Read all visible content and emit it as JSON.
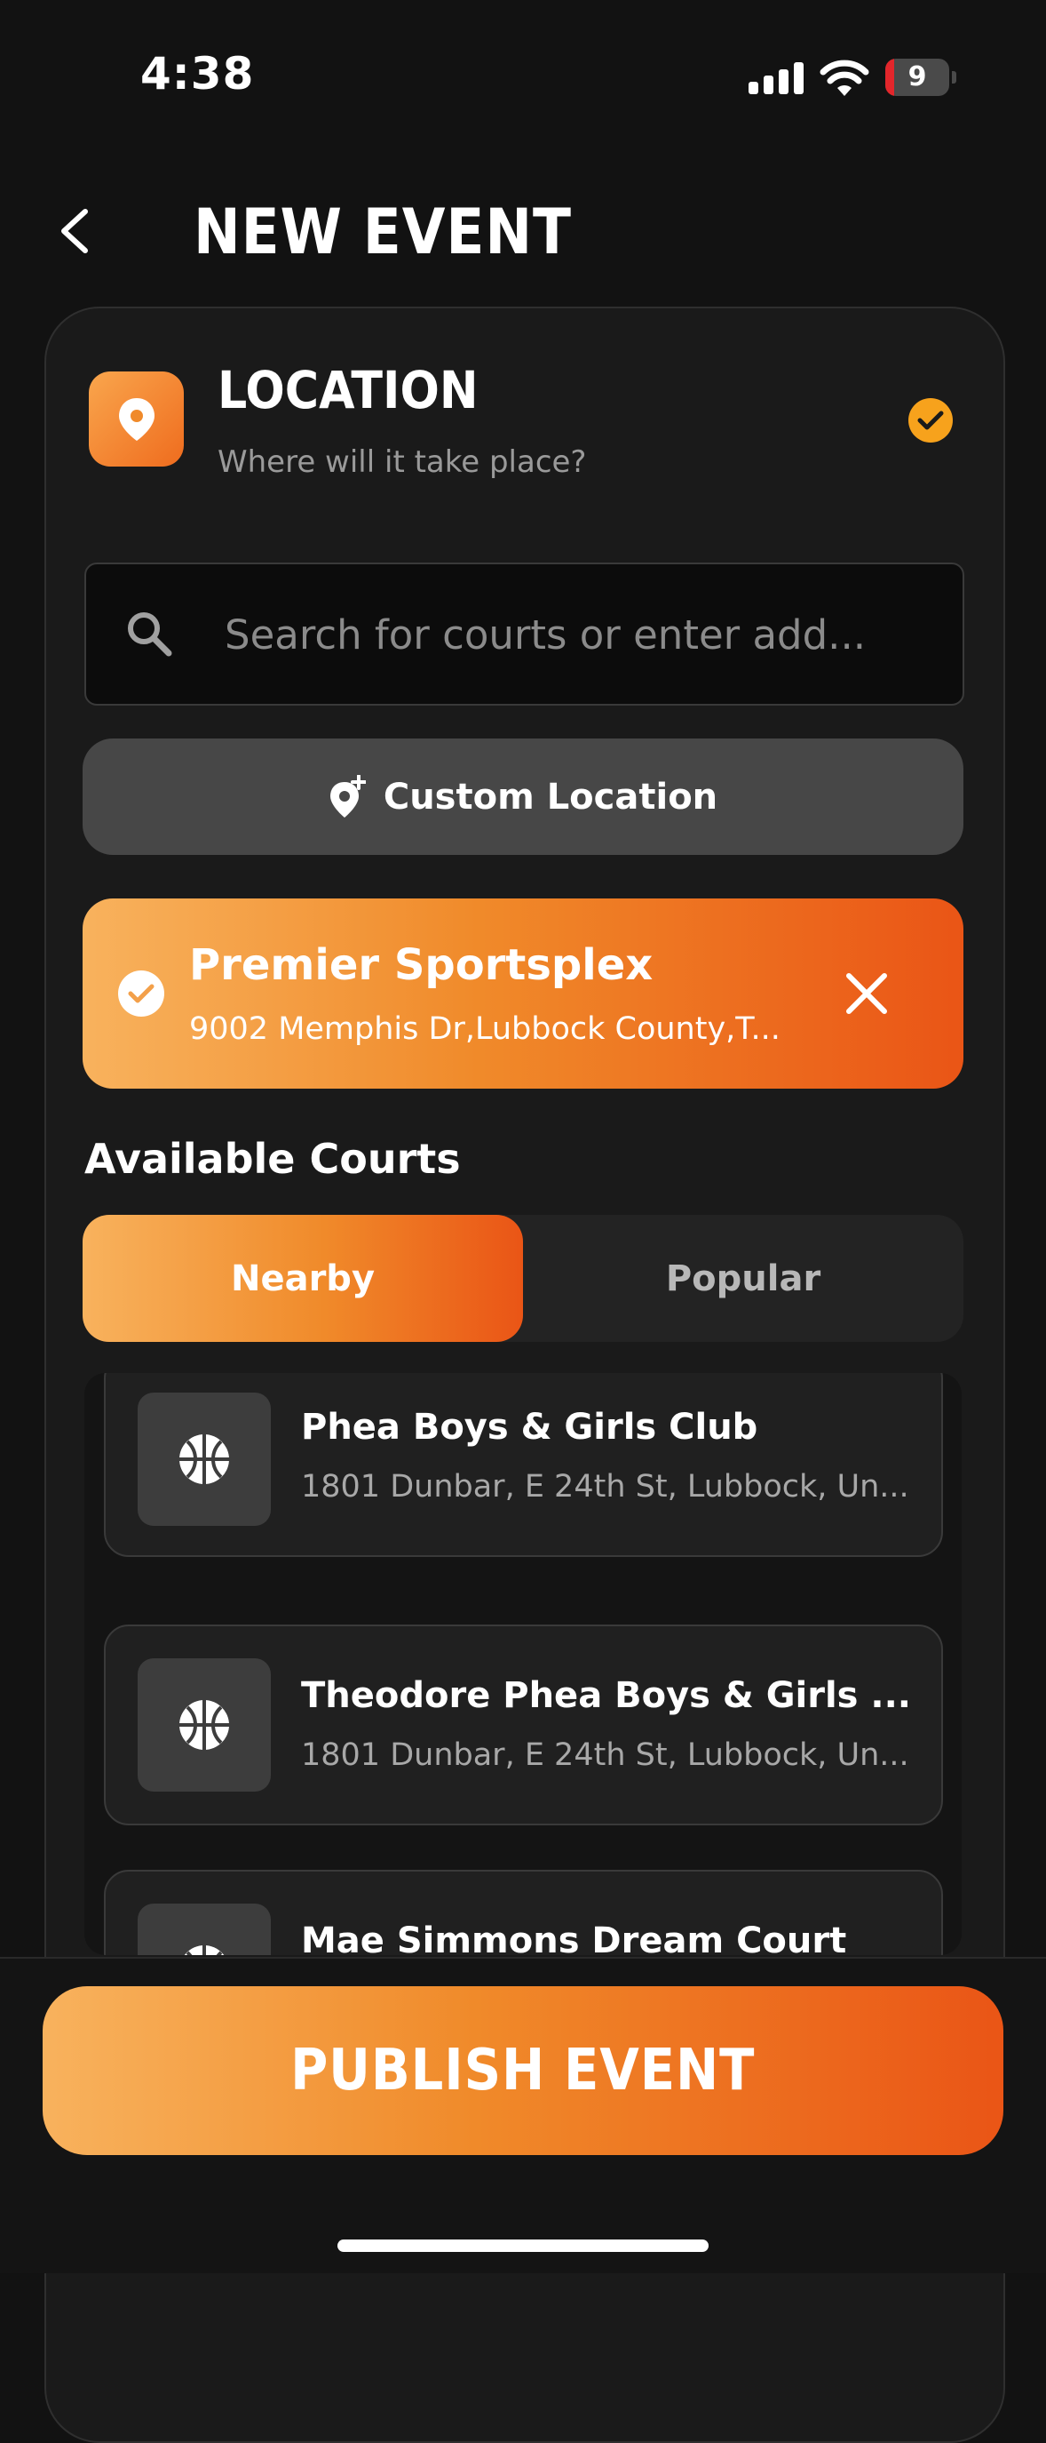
{
  "status_bar": {
    "time": "4:38",
    "battery_level": "9"
  },
  "header": {
    "title": "NEW EVENT"
  },
  "location_section": {
    "title": "LOCATION",
    "subtitle": "Where will it take place?",
    "complete": true
  },
  "search": {
    "placeholder": "Search for courts or enter add..."
  },
  "custom_location": {
    "label": "Custom Location"
  },
  "selected_location": {
    "name": "Premier Sportsplex",
    "address": "9002 Memphis Dr,Lubbock County,T..."
  },
  "available_courts": {
    "heading": "Available Courts",
    "tabs": [
      {
        "label": "Nearby",
        "active": true
      },
      {
        "label": "Popular",
        "active": false
      }
    ],
    "courts": [
      {
        "name": "Phea Boys & Girls Club",
        "address": "1801 Dunbar, E 24th St, Lubbock, Un..."
      },
      {
        "name": "Theodore Phea Boys & Girls ...",
        "address": "1801 Dunbar, E 24th St, Lubbock, Un..."
      },
      {
        "name": "Mae Simmons Dream Court",
        "address": ""
      }
    ]
  },
  "publish": {
    "label": "PUBLISH EVENT"
  },
  "colors": {
    "accent_orange": "#F08A2A",
    "gradient_start": "#F8B25D",
    "gradient_end": "#EA5516",
    "background": "#121212",
    "check_badge": "#F7A21C"
  },
  "icons": [
    "chevron-left-icon",
    "map-pin-icon",
    "check-circle-icon",
    "search-icon",
    "add-location-icon",
    "close-icon",
    "basketball-icon"
  ]
}
